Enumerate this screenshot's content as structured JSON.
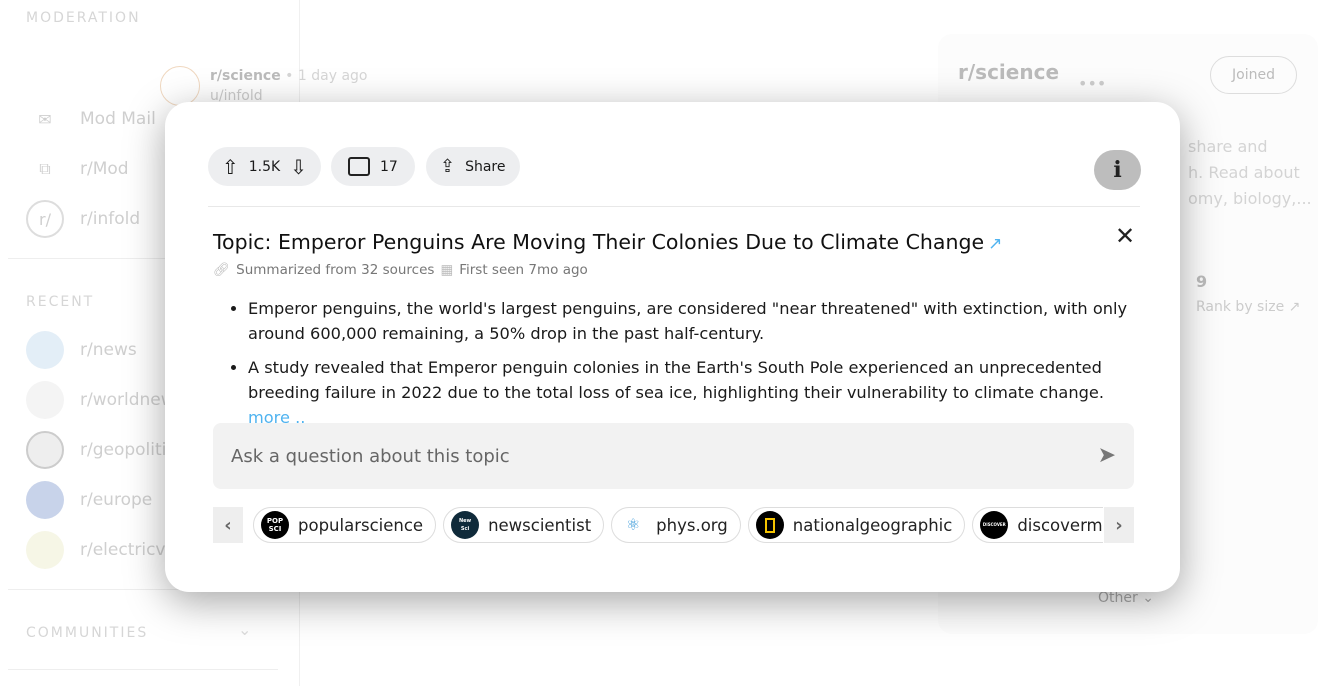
{
  "sidebar": {
    "moderation_header": "MODERATION",
    "mod_items": [
      {
        "label": "Mod Mail",
        "icon": "mail-icon"
      },
      {
        "label": "r/Mod",
        "icon": "mod-queue-icon"
      },
      {
        "label": "r/infold",
        "icon": "subreddit-icon"
      }
    ],
    "recent_header": "RECENT",
    "recent_items": [
      {
        "label": "r/news"
      },
      {
        "label": "r/worldnews"
      },
      {
        "label": "r/geopolitics"
      },
      {
        "label": "r/europe"
      },
      {
        "label": "r/electricvehicles"
      }
    ],
    "communities_header": "COMMUNITIES"
  },
  "post": {
    "subreddit": "r/science",
    "time": "• 1 day ago",
    "author": "u/infold"
  },
  "right_card": {
    "title": "r/science",
    "joined_label": "Joined",
    "description_fragments": [
      "share and",
      "h. Read about",
      "omy, biology,..."
    ],
    "rank_value": "9",
    "rank_label": "Rank by size",
    "other_label": "Other"
  },
  "modal": {
    "votes": "1.5K",
    "comments": "17",
    "share_label": "Share",
    "info_label": "i",
    "title": "Topic: Emperor Penguins Are Moving Their Colonies Due to Climate Change",
    "sources_meta": "Summarized from 32 sources",
    "first_seen": "First seen 7mo ago",
    "bullets": [
      "Emperor penguins, the world's largest penguins, are considered \"near threatened\" with extinction, with only around 600,000 remaining, a 50% drop in the past half-century.",
      "A study revealed that Emperor penguin colonies in the Earth's South Pole experienced an unprecedented breeding failure in 2022 due to the total loss of sea ice, highlighting their vulnerability to climate change."
    ],
    "more_label": "more ..",
    "ask_placeholder": "Ask a question about this topic",
    "sources": [
      {
        "name": "popularscience",
        "logo_text": "POP SCI",
        "color": "#000000"
      },
      {
        "name": "newscientist",
        "logo_text": "New Scientist",
        "color": "#0f2a3a"
      },
      {
        "name": "phys.org",
        "logo_text": "",
        "color": "#ffffff"
      },
      {
        "name": "nationalgeographic",
        "logo_text": "",
        "color": "#000000"
      },
      {
        "name": "discovermagazine",
        "logo_text": "DISCOVER",
        "color": "#000000"
      }
    ],
    "link_color": "#4fb3f0"
  }
}
